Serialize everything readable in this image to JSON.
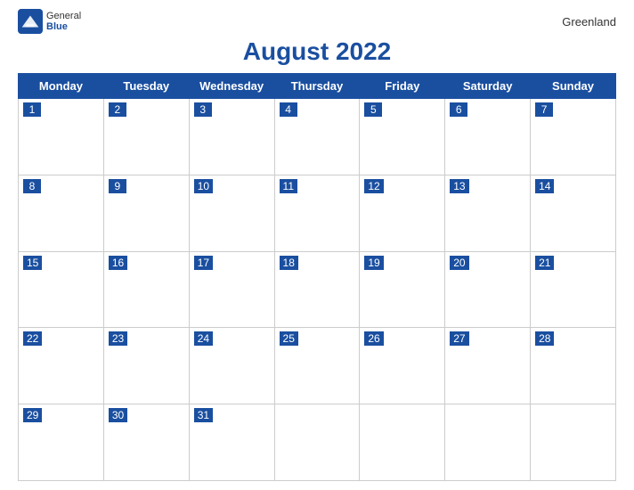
{
  "logo": {
    "general": "General",
    "blue": "Blue",
    "icon_color": "#1a4fa0"
  },
  "title": "August 2022",
  "region": "Greenland",
  "header": {
    "days": [
      "Monday",
      "Tuesday",
      "Wednesday",
      "Thursday",
      "Friday",
      "Saturday",
      "Sunday"
    ]
  },
  "weeks": [
    {
      "dates": [
        1,
        2,
        3,
        4,
        5,
        6,
        7
      ],
      "empty_before": 0
    },
    {
      "dates": [
        8,
        9,
        10,
        11,
        12,
        13,
        14
      ],
      "empty_before": 0
    },
    {
      "dates": [
        15,
        16,
        17,
        18,
        19,
        20,
        21
      ],
      "empty_before": 0
    },
    {
      "dates": [
        22,
        23,
        24,
        25,
        26,
        27,
        28
      ],
      "empty_before": 0
    },
    {
      "dates": [
        29,
        30,
        31,
        null,
        null,
        null,
        null
      ],
      "empty_before": 0
    }
  ]
}
